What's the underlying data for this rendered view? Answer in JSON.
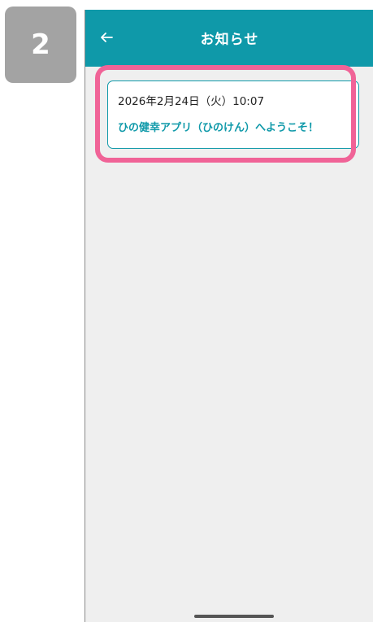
{
  "step_badge": {
    "number": "2"
  },
  "header": {
    "back_icon": "arrow-left-icon",
    "title": "お知らせ"
  },
  "notices": [
    {
      "date": "2026年2月24日（火）10:07",
      "title": "ひの健幸アプリ（ひのけん）へようこそ！"
    }
  ],
  "colors": {
    "header_bg": "#0f99a9",
    "accent": "#0f99a9",
    "highlight": "#f06397",
    "badge_bg": "#a3a3a3",
    "screen_bg": "#efefef"
  }
}
